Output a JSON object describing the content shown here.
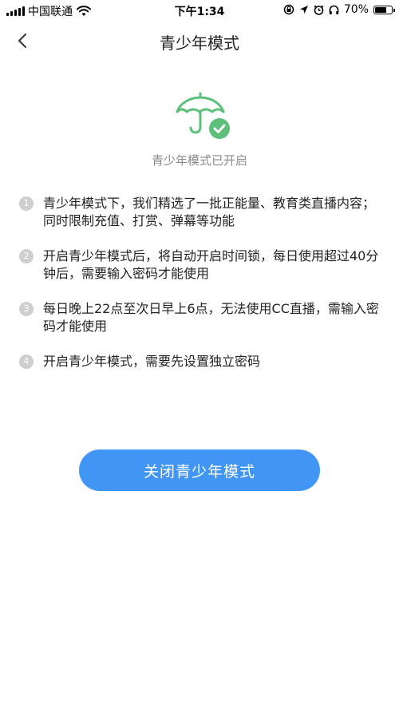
{
  "statusbar": {
    "carrier": "中国联通",
    "time": "下午1:34",
    "battery": "70%",
    "battery_level": 0.7
  },
  "nav": {
    "title": "青少年模式"
  },
  "hero": {
    "status_text": "青少年模式已开启",
    "icon": "umbrella-check-icon",
    "icon_color": "#5cc07a"
  },
  "rules": [
    {
      "num": "1",
      "text": "青少年模式下，我们精选了一批正能量、教育类直播内容；同时限制充值、打赏、弹幕等功能"
    },
    {
      "num": "2",
      "text": "开启青少年模式后，将自动开启时间锁，每日使用超过40分钟后，需要输入密码才能使用"
    },
    {
      "num": "3",
      "text": "每日晚上22点至次日早上6点，无法使用CC直播，需输入密码才能使用"
    },
    {
      "num": "4",
      "text": "开启青少年模式，需要先设置独立密码"
    }
  ],
  "actions": {
    "close_label": "关闭青少年模式",
    "accent_color": "#4195f5"
  }
}
